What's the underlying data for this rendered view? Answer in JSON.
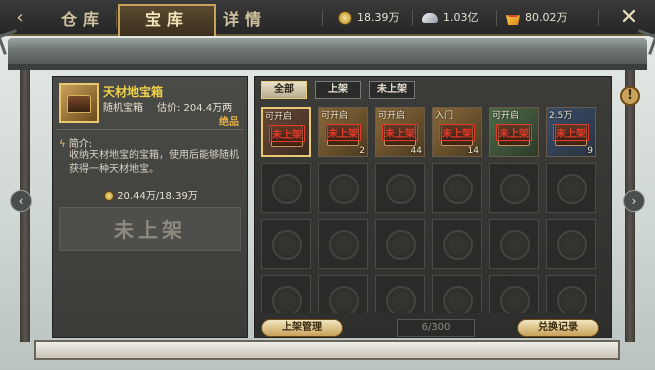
{
  "topbar": {
    "back_icon": "‹",
    "tabs": [
      {
        "label": "仓库",
        "active": false
      },
      {
        "label": "宝库",
        "active": true
      },
      {
        "label": "详情",
        "active": false
      }
    ],
    "currencies": [
      {
        "icon": "copper-coin-icon",
        "value": "18.39万"
      },
      {
        "icon": "silver-ingot-icon",
        "value": "1.03亿"
      },
      {
        "icon": "gold-ingot-icon",
        "value": "80.02万"
      }
    ],
    "close_icon": "✕"
  },
  "help_icon": "!",
  "nav": {
    "prev": "‹",
    "next": "›"
  },
  "detail": {
    "name": "天材地宝箱",
    "type": "随机宝箱",
    "price": "估价: 204.4万两",
    "grade": "绝品",
    "desc_title": "简介:",
    "desc_body": "收纳天材地宝的宝箱，使用后能够随机获得一种天材地宝。",
    "stat": "20.44万/18.39万",
    "status": "未上架"
  },
  "filters": [
    {
      "label": "全部",
      "active": true
    },
    {
      "label": "上架",
      "active": false
    },
    {
      "label": "未上架",
      "active": false
    }
  ],
  "slots": [
    {
      "top_label": "可开启",
      "stamp": "未上架",
      "count": "",
      "grade": "gold"
    },
    {
      "top_label": "可开启",
      "stamp": "未上架",
      "count": "2",
      "grade": "goldgrade"
    },
    {
      "top_label": "可开启",
      "stamp": "未上架",
      "count": "44",
      "grade": "goldgrade"
    },
    {
      "top_label": "入门",
      "stamp": "未上架",
      "count": "14",
      "grade": "goldgrade"
    },
    {
      "top_label": "可开启",
      "stamp": "未上架",
      "count": "",
      "grade": "greengrade"
    },
    {
      "top_label": "2.5万",
      "stamp": "未上架",
      "count": "9",
      "grade": "bluegrade"
    }
  ],
  "empty_slot_count": 18,
  "bottom": {
    "manage": "上架管理",
    "capacity": "6/300",
    "record": "兑换记录"
  }
}
